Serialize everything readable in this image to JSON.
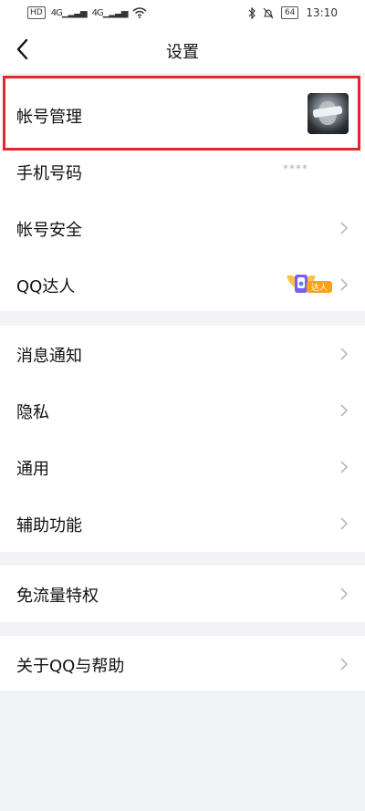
{
  "status_bar": {
    "left_badges": [
      "HD",
      "4G",
      "4G"
    ],
    "battery": "64",
    "time": "13:10"
  },
  "nav": {
    "title": "设置"
  },
  "groups": [
    {
      "items": [
        {
          "label": "帐号管理",
          "trailing": "avatar"
        },
        {
          "label": "手机号码",
          "trailing": "masked",
          "value": "****"
        },
        {
          "label": "帐号安全",
          "trailing": "chevron"
        },
        {
          "label": "QQ达人",
          "trailing": "badge",
          "badge_text": "达人"
        }
      ]
    },
    {
      "items": [
        {
          "label": "消息通知",
          "trailing": "chevron"
        },
        {
          "label": "隐私",
          "trailing": "chevron"
        },
        {
          "label": "通用",
          "trailing": "chevron"
        },
        {
          "label": "辅助功能",
          "trailing": "chevron"
        }
      ]
    },
    {
      "items": [
        {
          "label": "免流量特权",
          "trailing": "chevron"
        }
      ]
    },
    {
      "items": [
        {
          "label": "关于QQ与帮助",
          "trailing": "chevron"
        }
      ]
    }
  ],
  "colors": {
    "page_bg": "#f2f3f7",
    "row_bg": "#ffffff",
    "highlight": "#e5242b",
    "chevron": "#b8b8b8",
    "badge_orange": "#f7a21b"
  }
}
